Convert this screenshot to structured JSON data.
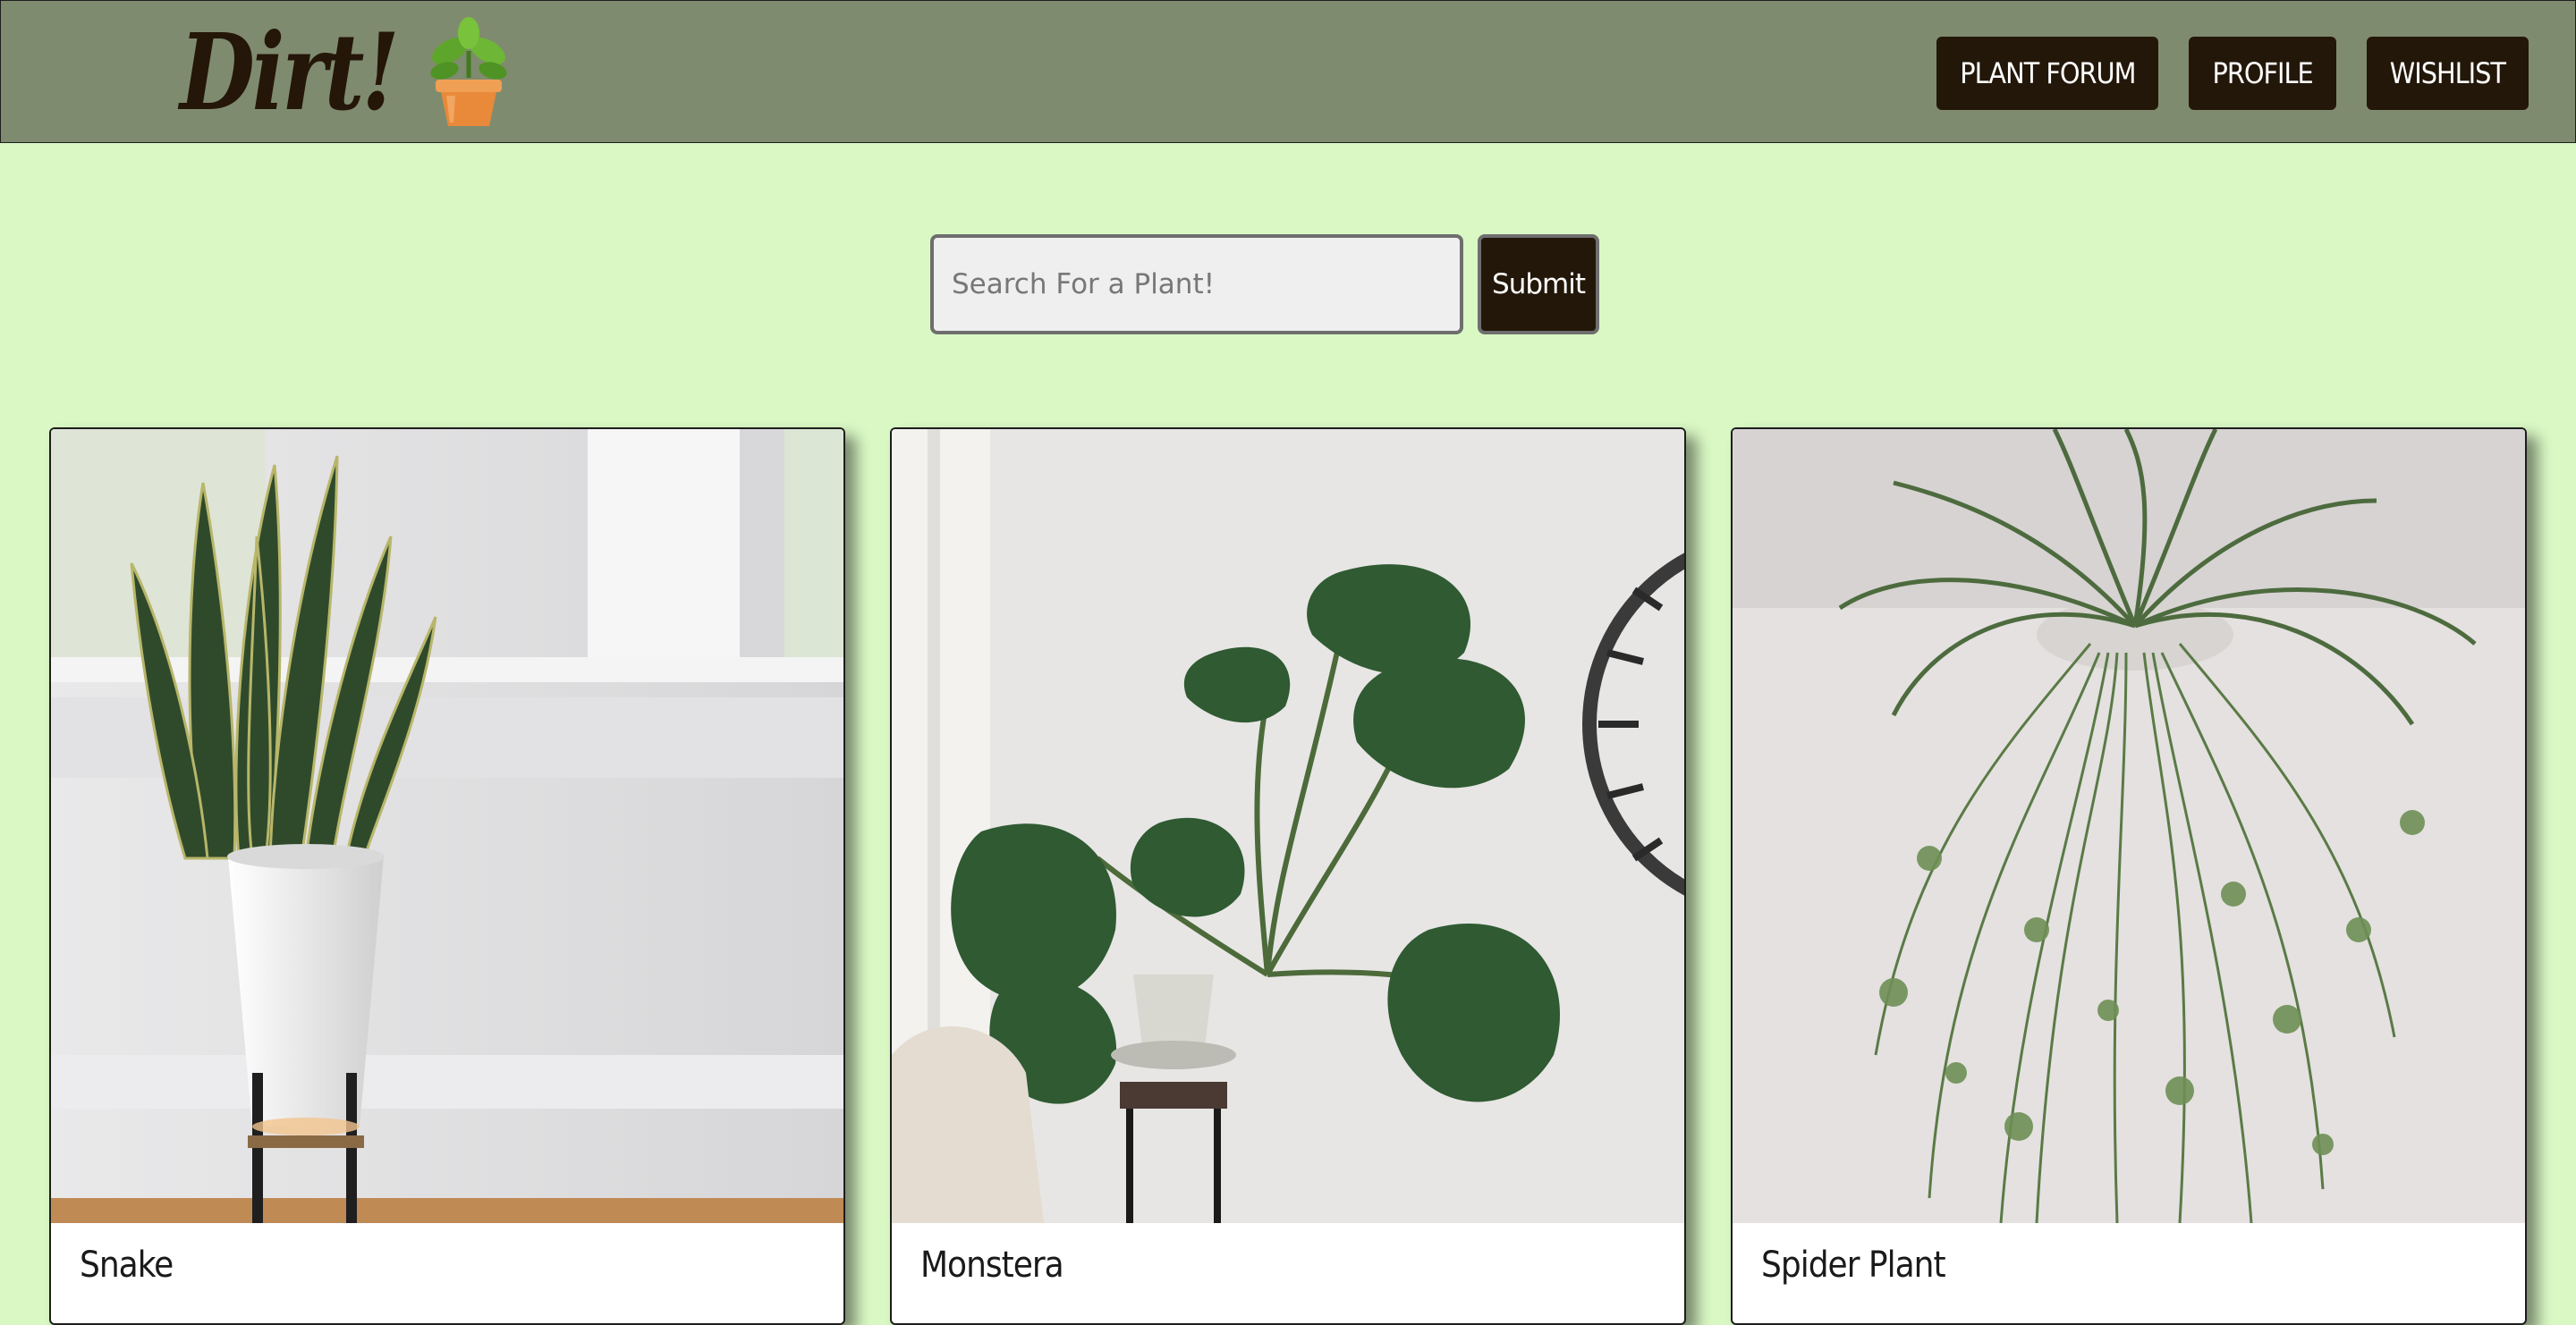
{
  "brand": {
    "name": "Dirt!",
    "icon": "potted-plant-icon"
  },
  "nav": {
    "items": [
      {
        "label": "PLANT FORUM"
      },
      {
        "label": "PROFILE"
      },
      {
        "label": "WISHLIST"
      }
    ]
  },
  "search": {
    "placeholder": "Search For a Plant!",
    "value": "",
    "submit_label": "Submit"
  },
  "plants": [
    {
      "name": "Snake"
    },
    {
      "name": "Monstera"
    },
    {
      "name": "Spider Plant"
    }
  ],
  "colors": {
    "page_background": "#d9f8c4",
    "navbar_background": "#7f8b6e",
    "button_background": "#231709",
    "button_text": "#ffffff",
    "card_background": "#ffffff"
  }
}
